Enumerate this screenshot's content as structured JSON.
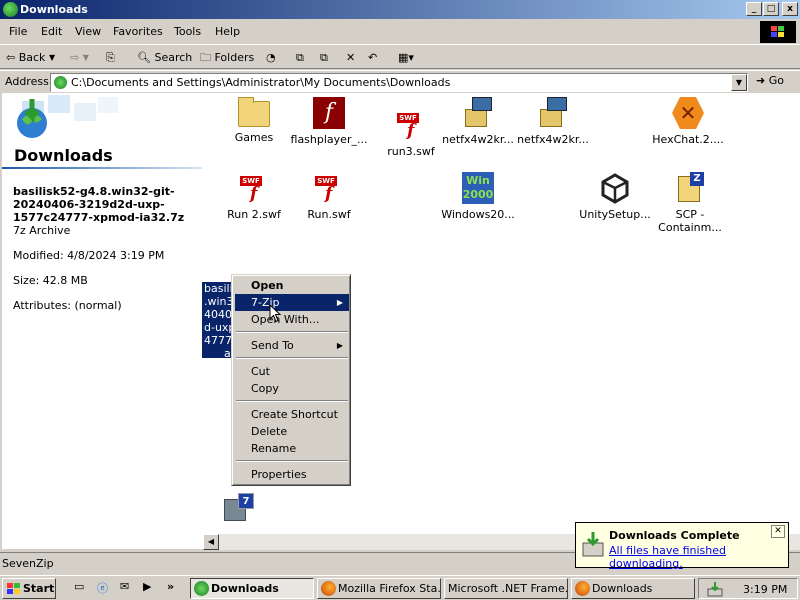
{
  "window": {
    "title": "Downloads"
  },
  "title_buttons": {
    "minimize": "_",
    "maximize": "□",
    "close": "x"
  },
  "menu": [
    "File",
    "Edit",
    "View",
    "Favorites",
    "Tools",
    "Help"
  ],
  "toolbar": {
    "back": "Back",
    "search": "Search",
    "folders": "Folders"
  },
  "address": {
    "label": "Address",
    "path": "C:\\Documents and Settings\\Administrator\\My Documents\\Downloads",
    "go": "Go"
  },
  "left_pane": {
    "title": "Downloads",
    "file_name": "basilisk52-g4.8.win32-git-20240406-3219d2d-uxp-1577c24777-xpmod-ia32.7z",
    "file_type": "7z Archive",
    "modified": "Modified: 4/8/2024 3:19 PM",
    "size": "Size: 42.8 MB",
    "attributes": "Attributes: (normal)"
  },
  "files": [
    {
      "label": "Games",
      "icon": "folder-icon"
    },
    {
      "label": "flashplayer_...",
      "icon": "flash-icon"
    },
    {
      "label": "run3.swf",
      "icon": "swf-icon"
    },
    {
      "label": "netfx4w2kr...",
      "icon": "setup-icon"
    },
    {
      "label": "netfx4w2kr...",
      "icon": "setup-icon"
    },
    {
      "label": "HexChat.2....",
      "icon": "hexchat-icon"
    },
    {
      "label": "Run 2.swf",
      "icon": "swf-icon"
    },
    {
      "label": "Run.swf",
      "icon": "swf-icon"
    },
    {
      "label": "Windows20...",
      "icon": "windows2000-icon"
    },
    {
      "label": "UnitySetup...",
      "icon": "unity-icon"
    },
    {
      "label": "SCP - Containm...",
      "icon": "7zip-icon"
    }
  ],
  "selected_file": {
    "lines": [
      "basilis",
      ".win32",
      "40406",
      "d-uxp",
      "4777-",
      "ai"
    ]
  },
  "context_menu": {
    "items": [
      {
        "label": "Open",
        "bold": true
      },
      {
        "label": "7-Zip",
        "submenu": true,
        "highlighted": true
      },
      {
        "label": "Open With..."
      },
      {
        "label": "Send To",
        "submenu": true
      },
      {
        "label": "Cut"
      },
      {
        "label": "Copy"
      },
      {
        "label": "Create Shortcut"
      },
      {
        "label": "Delete"
      },
      {
        "label": "Rename"
      },
      {
        "label": "Properties"
      }
    ]
  },
  "status_bar": {
    "text": "SevenZip"
  },
  "balloon": {
    "title": "Downloads Complete",
    "link": "All files have finished downloading."
  },
  "taskbar": {
    "start": "Start",
    "tasks": [
      {
        "label": "Downloads",
        "active": true
      },
      {
        "label": "Mozilla Firefox Sta..."
      },
      {
        "label": "Microsoft .NET Frame..."
      },
      {
        "label": "Downloads"
      }
    ],
    "clock": "3:19 PM"
  },
  "colors": {
    "title_start": "#0a246a",
    "title_end": "#a6caf0",
    "selection": "#0a246a",
    "face": "#d4d0c8"
  }
}
